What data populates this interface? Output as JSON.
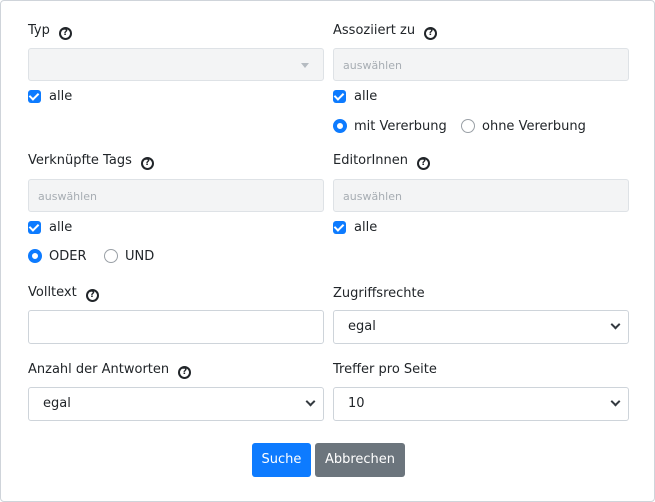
{
  "typ": {
    "label": "Typ",
    "all_label": "alle"
  },
  "assoziiert": {
    "label": "Assoziiert zu",
    "placeholder": "auswählen",
    "all_label": "alle",
    "radio_with": "mit Vererbung",
    "radio_without": "ohne Vererbung"
  },
  "tags": {
    "label": "Verknüpfte Tags",
    "placeholder": "auswählen",
    "all_label": "alle",
    "radio_or": "ODER",
    "radio_and": "UND"
  },
  "editors": {
    "label": "EditorInnen",
    "placeholder": "auswählen",
    "all_label": "alle"
  },
  "volltext": {
    "label": "Volltext",
    "value": ""
  },
  "zugriff": {
    "label": "Zugriffsrechte",
    "value": "egal"
  },
  "antworten": {
    "label": "Anzahl der Antworten",
    "value": "egal"
  },
  "treffer": {
    "label": "Treffer pro Seite",
    "value": "10"
  },
  "buttons": {
    "search": "Suche",
    "cancel": "Abbrechen"
  },
  "colors": {
    "accent": "#0d7bff",
    "secondary": "#6c757d"
  }
}
